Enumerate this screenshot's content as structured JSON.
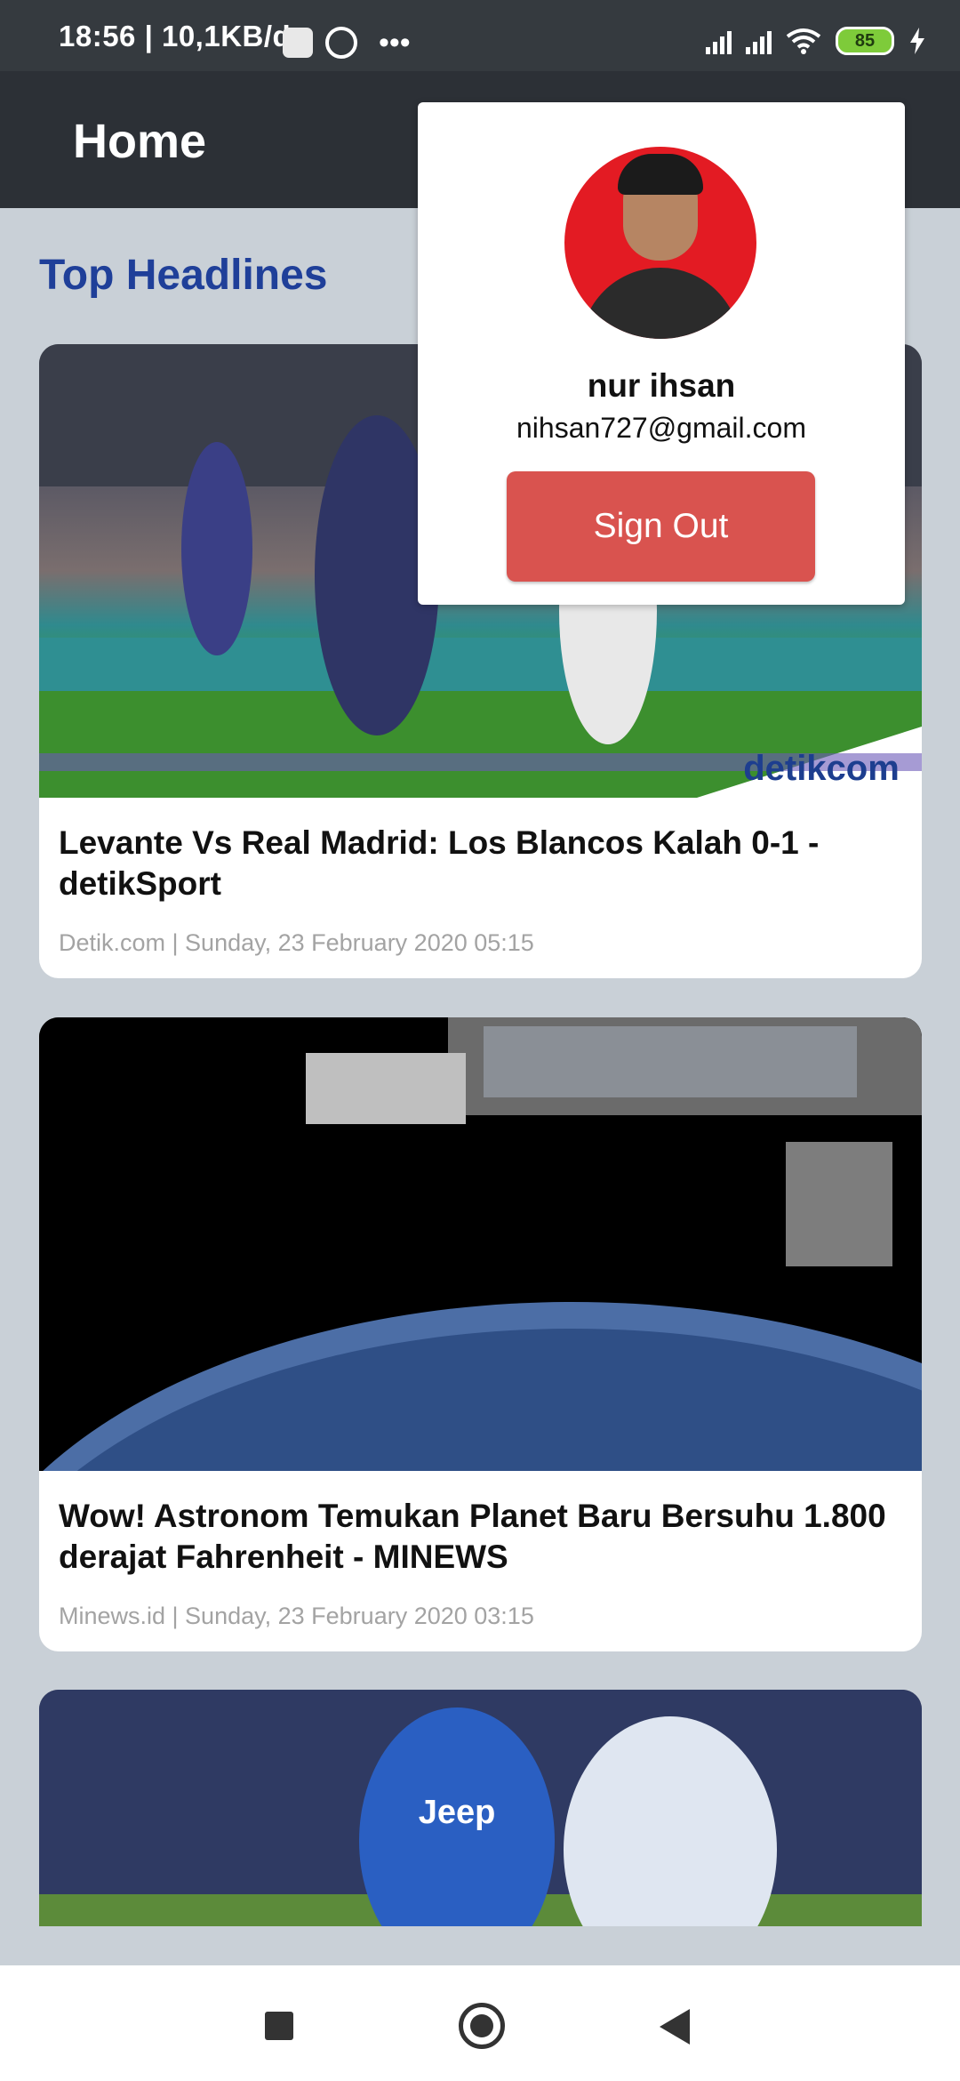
{
  "status_bar": {
    "time": "18:56 | 10,1KB/d",
    "battery": "85"
  },
  "app_bar": {
    "title": "Home"
  },
  "section": {
    "title": "Top Headlines"
  },
  "articles": [
    {
      "title": "Levante Vs Real Madrid: Los Blancos Kalah 0-1 - detikSport",
      "meta": "Detik.com | Sunday, 23 February 2020 05:15"
    },
    {
      "title": "Wow! Astronom Temukan Planet Baru Bersuhu 1.800 derajat Fahrenheit - MINEWS",
      "meta": "Minews.id | Sunday, 23 February 2020 03:15"
    },
    {
      "title": "",
      "meta": ""
    }
  ],
  "account_popup": {
    "name": "nur ihsan",
    "email": "nihsan727@gmail.com",
    "sign_out_label": "Sign Out"
  },
  "icons": {
    "nav_recents": "square-icon",
    "nav_home": "circle-icon",
    "nav_back": "back-triangle-icon"
  },
  "colors": {
    "app_bar": "#2c3036",
    "section_title": "#1f3f99",
    "sign_out_button": "#d9534f",
    "background": "#c9d0d7"
  }
}
